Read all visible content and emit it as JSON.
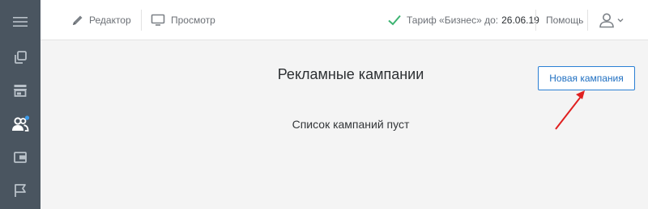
{
  "sidebar": {
    "items": [
      {
        "name": "menu-icon"
      },
      {
        "name": "copy-icon"
      },
      {
        "name": "store-icon"
      },
      {
        "name": "users-icon"
      },
      {
        "name": "wallet-icon"
      },
      {
        "name": "flag-icon"
      }
    ],
    "colors": {
      "icon": "#b9c1c9",
      "active_icon": "#ffffff",
      "badge": "#3d9be9",
      "background": "#4a5560"
    }
  },
  "header": {
    "editor_label": "Редактор",
    "preview_label": "Просмотр",
    "tariff_label": "Тариф «Бизнес» до:",
    "tariff_date": "26.06.19",
    "help_label": "Помощь",
    "check_color": "#3cb371"
  },
  "main": {
    "title": "Рекламные кампании",
    "new_campaign_label": "Новая кампания",
    "empty_text": "Список кампаний пуст",
    "accent_color": "#2a7fd4",
    "arrow_color": "#e02020"
  }
}
